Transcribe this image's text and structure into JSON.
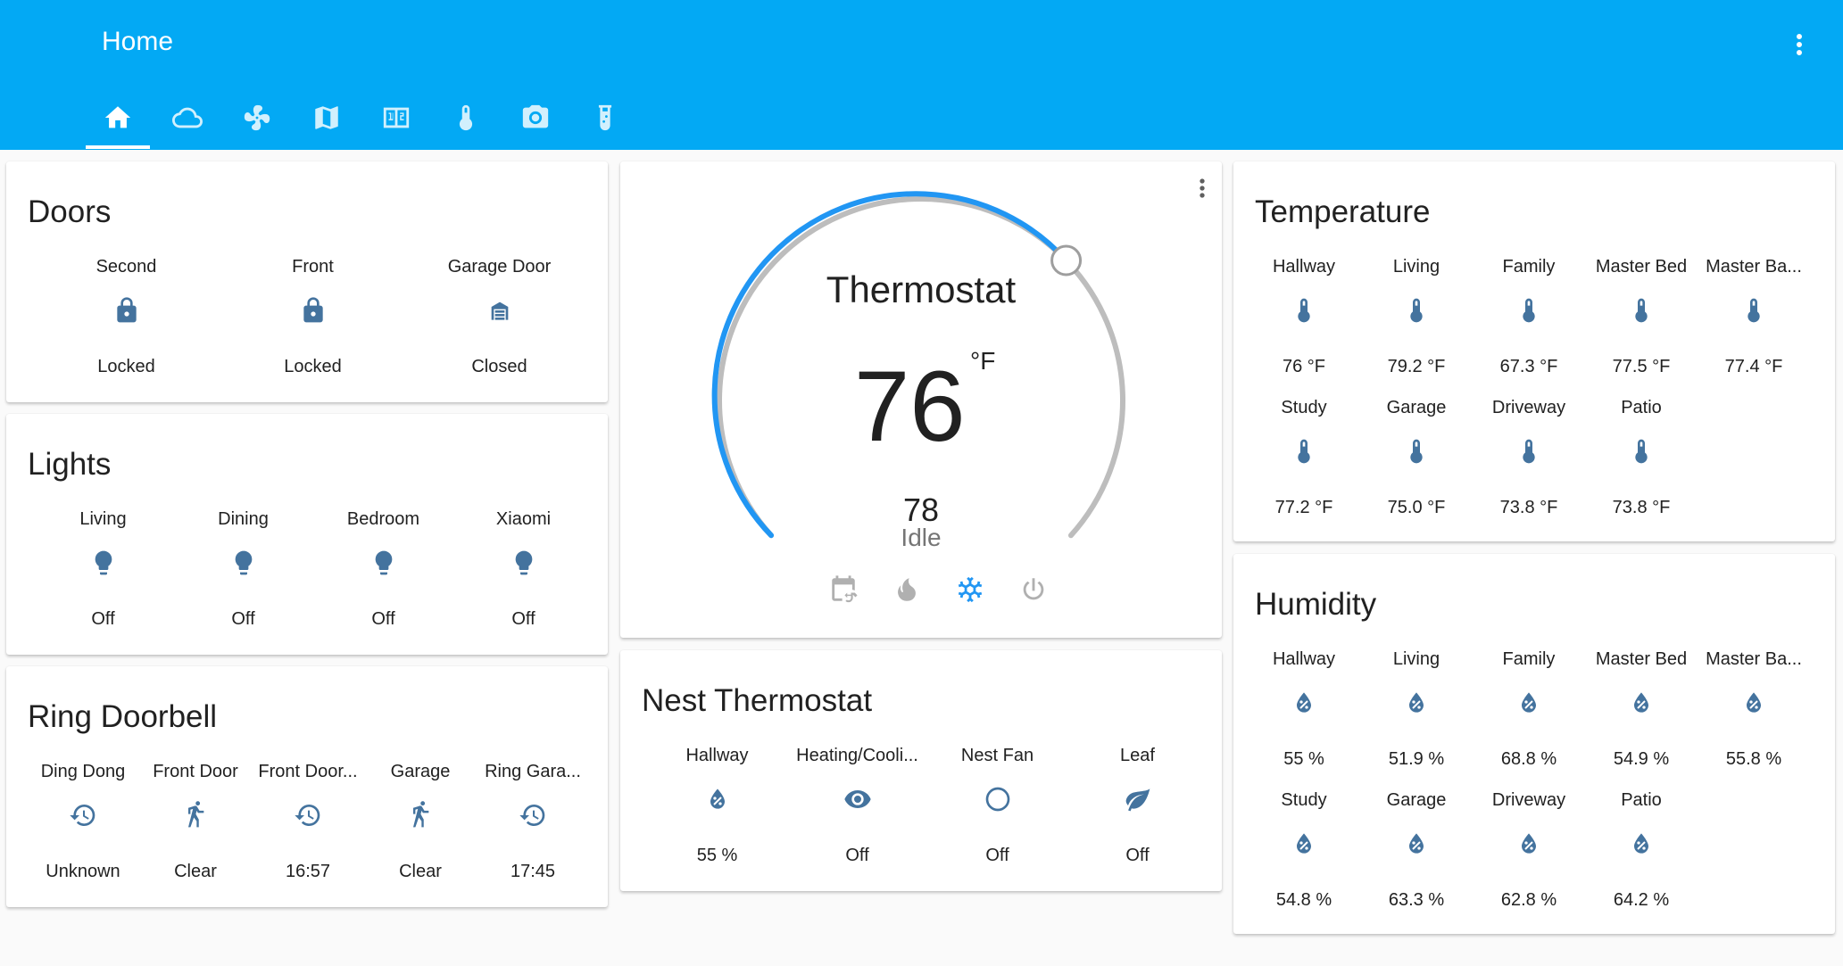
{
  "header": {
    "title": "Home",
    "menu_icon": "dots-vertical-icon",
    "accent_color": "#03a9f4",
    "tabs": [
      {
        "icon": "home-icon",
        "selected": true
      },
      {
        "icon": "cloud-icon",
        "selected": false
      },
      {
        "icon": "fan-icon",
        "selected": false
      },
      {
        "icon": "map-icon",
        "selected": false
      },
      {
        "icon": "calendar-icon",
        "selected": false
      },
      {
        "icon": "thermometer-icon",
        "selected": false
      },
      {
        "icon": "camera-icon",
        "selected": false
      },
      {
        "icon": "test-tube-icon",
        "selected": false
      }
    ]
  },
  "colors": {
    "icon": "#44739e",
    "thermostat_arc": "#2196f3",
    "thermostat_track": "#bdbdbd"
  },
  "doors": {
    "title": "Doors",
    "entities": [
      {
        "name": "Second",
        "icon": "lock-icon",
        "state": "Locked"
      },
      {
        "name": "Front",
        "icon": "lock-icon",
        "state": "Locked"
      },
      {
        "name": "Garage Door",
        "icon": "garage-icon",
        "state": "Closed"
      }
    ]
  },
  "lights": {
    "title": "Lights",
    "entities": [
      {
        "name": "Living",
        "icon": "lightbulb-icon",
        "state": "Off"
      },
      {
        "name": "Dining",
        "icon": "lightbulb-icon",
        "state": "Off"
      },
      {
        "name": "Bedroom",
        "icon": "lightbulb-icon",
        "state": "Off"
      },
      {
        "name": "Xiaomi",
        "icon": "lightbulb-icon",
        "state": "Off"
      }
    ]
  },
  "ring": {
    "title": "Ring Doorbell",
    "entities": [
      {
        "name": "Ding Dong",
        "icon": "history-icon",
        "state": "Unknown"
      },
      {
        "name": "Front Door",
        "icon": "walk-icon",
        "state": "Clear"
      },
      {
        "name": "Front Door...",
        "icon": "history-icon",
        "state": "16:57"
      },
      {
        "name": "Garage",
        "icon": "walk-icon",
        "state": "Clear"
      },
      {
        "name": "Ring Gara...",
        "icon": "history-icon",
        "state": "17:45"
      }
    ]
  },
  "thermostat": {
    "title": "Thermostat",
    "current": "76",
    "unit": "°F",
    "target": "78",
    "action": "Idle",
    "menu_icon": "dots-vertical-icon",
    "modes": [
      {
        "icon": "calendar-sync-icon",
        "active": false
      },
      {
        "icon": "fire-icon",
        "active": false
      },
      {
        "icon": "snowflake-icon",
        "active": true
      },
      {
        "icon": "power-icon",
        "active": false
      }
    ]
  },
  "nest": {
    "title": "Nest Thermostat",
    "entities": [
      {
        "name": "Hallway",
        "icon": "water-percent-icon",
        "state": "55 %"
      },
      {
        "name": "Heating/Cooli...",
        "icon": "eye-icon",
        "state": "Off"
      },
      {
        "name": "Nest Fan",
        "icon": "circle-outline-icon",
        "state": "Off"
      },
      {
        "name": "Leaf",
        "icon": "leaf-icon",
        "state": "Off"
      }
    ]
  },
  "temperature": {
    "title": "Temperature",
    "entities": [
      {
        "name": "Hallway",
        "icon": "thermometer-icon",
        "state": "76 °F"
      },
      {
        "name": "Living",
        "icon": "thermometer-icon",
        "state": "79.2 °F"
      },
      {
        "name": "Family",
        "icon": "thermometer-icon",
        "state": "67.3 °F"
      },
      {
        "name": "Master Bed",
        "icon": "thermometer-icon",
        "state": "77.5 °F"
      },
      {
        "name": "Master Ba...",
        "icon": "thermometer-icon",
        "state": "77.4 °F"
      },
      {
        "name": "Study",
        "icon": "thermometer-icon",
        "state": "77.2 °F"
      },
      {
        "name": "Garage",
        "icon": "thermometer-icon",
        "state": "75.0 °F"
      },
      {
        "name": "Driveway",
        "icon": "thermometer-icon",
        "state": "73.8 °F"
      },
      {
        "name": "Patio",
        "icon": "thermometer-icon",
        "state": "73.8 °F"
      }
    ]
  },
  "humidity": {
    "title": "Humidity",
    "entities": [
      {
        "name": "Hallway",
        "icon": "water-percent-icon",
        "state": "55 %"
      },
      {
        "name": "Living",
        "icon": "water-percent-icon",
        "state": "51.9 %"
      },
      {
        "name": "Family",
        "icon": "water-percent-icon",
        "state": "68.8 %"
      },
      {
        "name": "Master Bed",
        "icon": "water-percent-icon",
        "state": "54.9 %"
      },
      {
        "name": "Master Ba...",
        "icon": "water-percent-icon",
        "state": "55.8 %"
      },
      {
        "name": "Study",
        "icon": "water-percent-icon",
        "state": "54.8 %"
      },
      {
        "name": "Garage",
        "icon": "water-percent-icon",
        "state": "63.3 %"
      },
      {
        "name": "Driveway",
        "icon": "water-percent-icon",
        "state": "62.8 %"
      },
      {
        "name": "Patio",
        "icon": "water-percent-icon",
        "state": "64.2 %"
      }
    ]
  }
}
